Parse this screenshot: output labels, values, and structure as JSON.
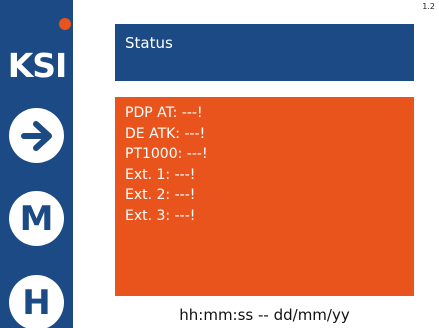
{
  "colors": {
    "sidebar": "#1b4a85",
    "accent": "#e8541c",
    "panel_text": "#ffffff"
  },
  "sidebar": {
    "logo": "KSI",
    "buttons": [
      {
        "icon": "arrow-right-icon",
        "label": ""
      },
      {
        "icon": "m-icon",
        "label": "M"
      },
      {
        "icon": "h-icon",
        "label": "H"
      }
    ]
  },
  "version": "1.2",
  "header": {
    "title": "Status"
  },
  "status": {
    "items": [
      "PDP AT: ---!",
      "DE ATK: ---!",
      "PT1000: ---!",
      "Ext. 1: ---!",
      "Ext. 2: ---!",
      "Ext. 3: ---!"
    ]
  },
  "footer": {
    "datetime": "hh:mm:ss -- dd/mm/yy"
  }
}
